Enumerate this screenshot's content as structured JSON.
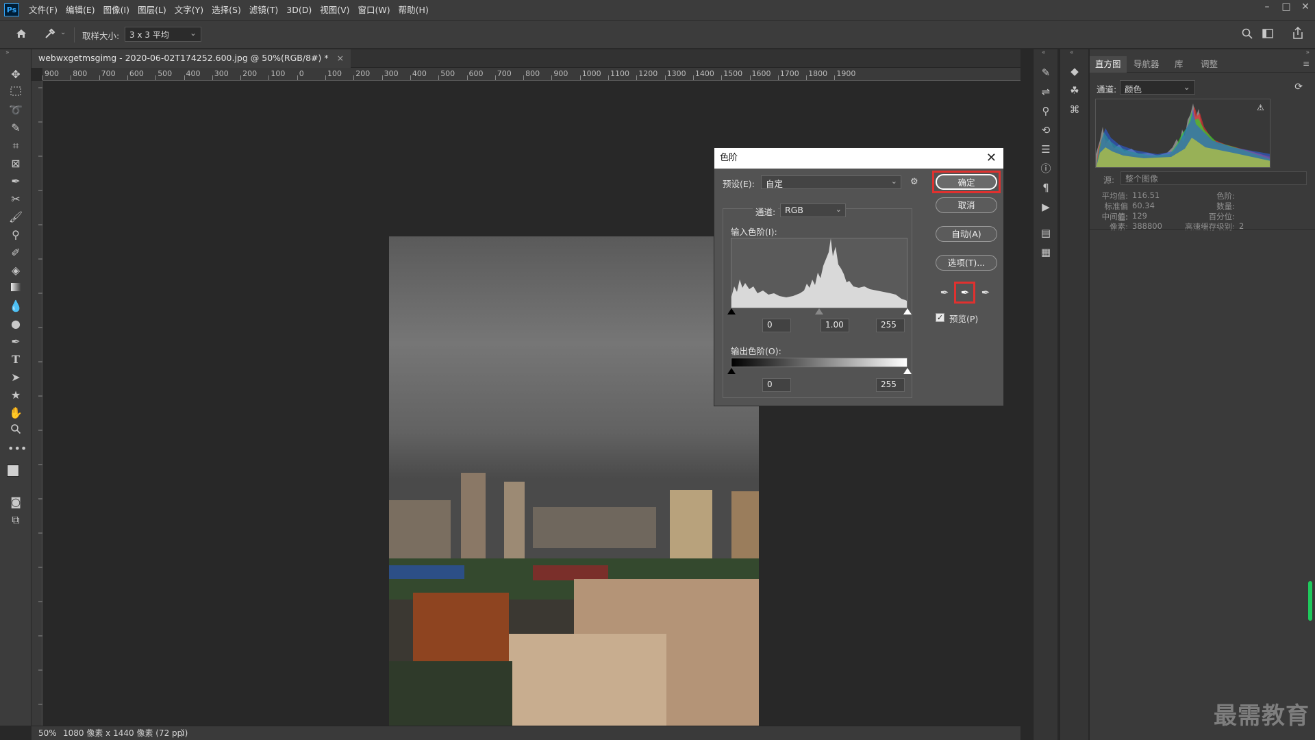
{
  "app": {
    "logo": "Ps"
  },
  "menubar": {
    "items": [
      "文件(F)",
      "编辑(E)",
      "图像(I)",
      "图层(L)",
      "文字(Y)",
      "选择(S)",
      "滤镜(T)",
      "3D(D)",
      "视图(V)",
      "窗口(W)",
      "帮助(H)"
    ]
  },
  "window_controls": {
    "minimize": "–",
    "restore": "□",
    "close": "✕"
  },
  "options_bar": {
    "sample_size_label": "取样大小:",
    "sample_size_value": "3 x 3 平均"
  },
  "document": {
    "tab_title": "webwxgetmsgimg - 2020-06-02T174252.600.jpg @ 50%(RGB/8#) *",
    "tab_close": "×",
    "ruler_labels": [
      "900",
      "800",
      "700",
      "600",
      "500",
      "400",
      "300",
      "200",
      "100",
      "0",
      "100",
      "200",
      "300",
      "400",
      "500",
      "600",
      "700",
      "800",
      "900",
      "1000",
      "1100",
      "1200",
      "1300",
      "1400",
      "1500",
      "1600",
      "1700",
      "1800",
      "1900"
    ]
  },
  "statusbar": {
    "zoom": "50%",
    "info": "1080 像素 x 1440 像素 (72 ppi)",
    "arrow": "〉"
  },
  "levels_dialog": {
    "title": "色阶",
    "preset_label": "预设(E):",
    "preset_value": "自定",
    "channel_label": "通道:",
    "channel_value": "RGB",
    "input_label": "输入色阶(I):",
    "input_black": "0",
    "input_gamma": "1.00",
    "input_white": "255",
    "output_label": "输出色阶(O):",
    "output_black": "0",
    "output_white": "255",
    "buttons": {
      "ok": "确定",
      "cancel": "取消",
      "auto": "自动(A)",
      "options": "选项(T)..."
    },
    "preview_label": "预览(P)",
    "preview_checked": true,
    "highlight_color": "#e0312f"
  },
  "right_panel": {
    "tabs": [
      "直方图",
      "导航器",
      "库",
      "调整"
    ],
    "active_tab": "直方图",
    "channel_label": "通道:",
    "channel_value": "颜色",
    "source_label": "源:",
    "source_value": "整个图像",
    "stats": {
      "mean_label": "平均值:",
      "mean_value": "116.51",
      "std_label": "标准偏差:",
      "std_value": "60.34",
      "median_label": "中间值:",
      "median_value": "129",
      "pixels_label": "像素:",
      "pixels_value": "388800",
      "level_label": "色阶:",
      "count_label": "数量:",
      "percentile_label": "百分位:",
      "cache_label": "高速缓存级别:",
      "cache_value": "2"
    }
  },
  "watermark": "最需教育"
}
